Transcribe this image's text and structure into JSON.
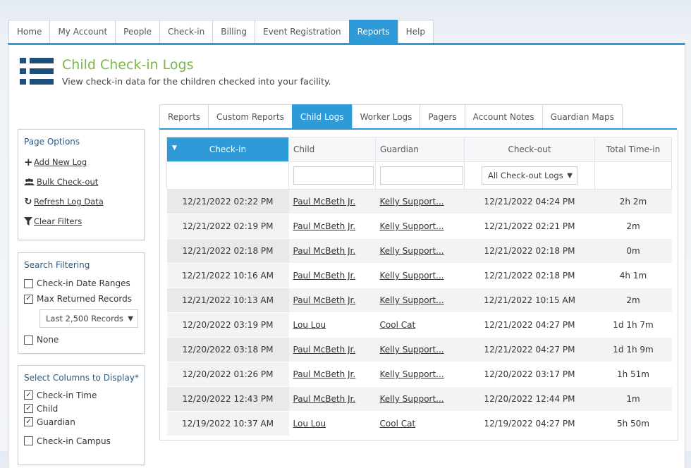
{
  "top_nav": {
    "tabs": [
      {
        "label": "Home"
      },
      {
        "label": "My Account"
      },
      {
        "label": "People"
      },
      {
        "label": "Check-in"
      },
      {
        "label": "Billing"
      },
      {
        "label": "Event Registration"
      },
      {
        "label": "Reports",
        "active": true
      },
      {
        "label": "Help"
      }
    ]
  },
  "header": {
    "title": "Child Check-in Logs",
    "subtitle": "View check-in data for the children checked into your facility.",
    "icon": "list-icon",
    "accent_color": "#2e9ad8",
    "title_color": "#7ab648"
  },
  "sub_tabs": [
    {
      "label": "Reports"
    },
    {
      "label": "Custom Reports"
    },
    {
      "label": "Child Logs",
      "active": true
    },
    {
      "label": "Worker Logs"
    },
    {
      "label": "Pagers"
    },
    {
      "label": "Account Notes"
    },
    {
      "label": "Guardian Maps"
    }
  ],
  "page_options": {
    "title": "Page Options",
    "items": [
      {
        "label": "Add New Log",
        "icon": "plus-icon"
      },
      {
        "label": "Bulk Check-out",
        "icon": "users-icon"
      },
      {
        "label": "Refresh Log Data",
        "icon": "refresh-icon"
      },
      {
        "label": "Clear Filters",
        "icon": "filter-icon"
      }
    ]
  },
  "search_filtering": {
    "title": "Search Filtering",
    "date_ranges": {
      "label": "Check-in Date Ranges",
      "checked": false
    },
    "max_records": {
      "label": "Max Returned Records",
      "checked": true
    },
    "records_select": "Last 2,500 Records",
    "none": {
      "label": "None",
      "checked": false
    }
  },
  "columns_box": {
    "title": "Select Columns to Display*",
    "items": [
      {
        "label": "Check-in Time",
        "checked": true
      },
      {
        "label": "Child",
        "checked": true
      },
      {
        "label": "Guardian",
        "checked": true
      },
      {
        "label": "Check-in Campus",
        "checked": false
      }
    ]
  },
  "table": {
    "columns": {
      "checkin": "Check-in",
      "child": "Child",
      "guardian": "Guardian",
      "checkout": "Check-out",
      "total": "Total Time-in"
    },
    "checkout_filter": "All Check-out Logs",
    "rows": [
      {
        "checkin": "12/21/2022 02:22 PM",
        "child": "Paul McBeth Jr.",
        "guardian": "Kelly Support...",
        "checkout": "12/21/2022 04:24 PM",
        "total": "2h 2m"
      },
      {
        "checkin": "12/21/2022 02:19 PM",
        "child": "Paul McBeth Jr.",
        "guardian": "Kelly Support...",
        "checkout": "12/21/2022 02:21 PM",
        "total": "2m"
      },
      {
        "checkin": "12/21/2022 02:18 PM",
        "child": "Paul McBeth Jr.",
        "guardian": "Kelly Support...",
        "checkout": "12/21/2022 02:18 PM",
        "total": "0m"
      },
      {
        "checkin": "12/21/2022 10:16 AM",
        "child": "Paul McBeth Jr.",
        "guardian": "Kelly Support...",
        "checkout": "12/21/2022 02:18 PM",
        "total": "4h 1m"
      },
      {
        "checkin": "12/21/2022 10:13 AM",
        "child": "Paul McBeth Jr.",
        "guardian": "Kelly Support...",
        "checkout": "12/21/2022 10:15 AM",
        "total": "2m"
      },
      {
        "checkin": "12/20/2022 03:19 PM",
        "child": "Lou Lou",
        "guardian": "Cool Cat",
        "checkout": "12/21/2022 04:27 PM",
        "total": "1d 1h 7m"
      },
      {
        "checkin": "12/20/2022 03:18 PM",
        "child": "Paul McBeth Jr.",
        "guardian": "Kelly Support...",
        "checkout": "12/21/2022 04:27 PM",
        "total": "1d 1h 9m"
      },
      {
        "checkin": "12/20/2022 01:26 PM",
        "child": "Paul McBeth Jr.",
        "guardian": "Kelly Support...",
        "checkout": "12/20/2022 03:17 PM",
        "total": "1h 51m"
      },
      {
        "checkin": "12/20/2022 12:43 PM",
        "child": "Paul McBeth Jr.",
        "guardian": "Kelly Support...",
        "checkout": "12/20/2022 12:44 PM",
        "total": "1m"
      },
      {
        "checkin": "12/19/2022 10:37 AM",
        "child": "Lou Lou",
        "guardian": "Cool Cat",
        "checkout": "12/19/2022 04:27 PM",
        "total": "5h 50m"
      }
    ]
  }
}
